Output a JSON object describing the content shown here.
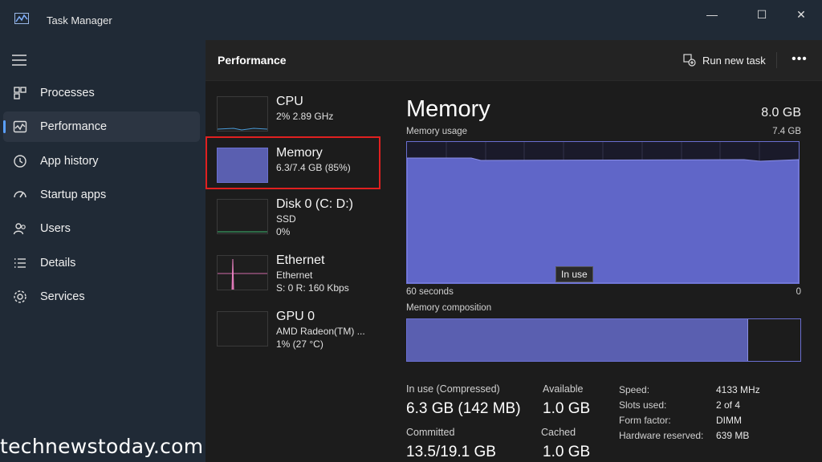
{
  "window": {
    "title": "Task Manager",
    "minimize": "—",
    "maximize": "☐",
    "close": "✕"
  },
  "sidebar": {
    "items": [
      {
        "label": "Processes",
        "icon": "processes-icon"
      },
      {
        "label": "Performance",
        "icon": "performance-icon",
        "active": true
      },
      {
        "label": "App history",
        "icon": "history-icon"
      },
      {
        "label": "Startup apps",
        "icon": "startup-icon"
      },
      {
        "label": "Users",
        "icon": "users-icon"
      },
      {
        "label": "Details",
        "icon": "details-icon"
      },
      {
        "label": "Services",
        "icon": "services-icon"
      }
    ]
  },
  "header": {
    "title": "Performance",
    "run_task": "Run new task",
    "more": "•••"
  },
  "tiles": [
    {
      "name": "CPU",
      "lines": [
        "2% 2.89 GHz"
      ]
    },
    {
      "name": "Memory",
      "lines": [
        "6.3/7.4 GB (85%)"
      ]
    },
    {
      "name": "Disk 0 (C: D:)",
      "lines": [
        "SSD",
        "0%"
      ]
    },
    {
      "name": "Ethernet",
      "lines": [
        "Ethernet",
        "S: 0 R: 160 Kbps"
      ]
    },
    {
      "name": "GPU 0",
      "lines": [
        "AMD Radeon(TM) ...",
        "1% (27 °C)"
      ]
    }
  ],
  "detail": {
    "title": "Memory",
    "total": "8.0 GB",
    "usage_label": "Memory usage",
    "usage_max": "7.4 GB",
    "x_left": "60 seconds",
    "x_right": "0",
    "tooltip": "In use",
    "composition_label": "Memory composition",
    "composition_in_use_fraction": 0.86,
    "stats": {
      "in_use_label": "In use (Compressed)",
      "in_use_value": "6.3 GB (142 MB)",
      "available_label": "Available",
      "available_value": "1.0 GB",
      "committed_label": "Committed",
      "committed_value": "13.5/19.1 GB",
      "cached_label": "Cached",
      "cached_value": "1.0 GB"
    },
    "kv": [
      {
        "label": "Speed:",
        "value": "4133 MHz"
      },
      {
        "label": "Slots used:",
        "value": "2 of 4"
      },
      {
        "label": "Form factor:",
        "value": "DIMM"
      },
      {
        "label": "Hardware reserved:",
        "value": "639 MB"
      }
    ]
  },
  "watermark": "technewstoday.com",
  "colors": {
    "accent": "#5aa0ff",
    "memory_fill": "#6066c8",
    "highlight": "#e02020"
  }
}
